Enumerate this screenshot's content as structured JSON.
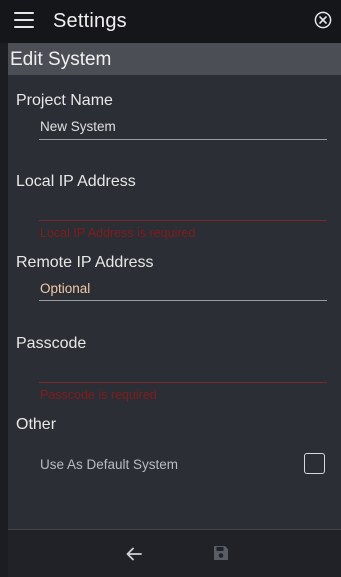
{
  "topbar": {
    "title": "Settings",
    "menu_icon": "hamburger-menu-icon",
    "close_icon": "close-circle-icon"
  },
  "panel": {
    "title": "Edit System"
  },
  "form": {
    "project_name": {
      "label": "Project Name",
      "value": "New System"
    },
    "local_ip": {
      "label": "Local IP Address",
      "value": "",
      "error": "Local IP Address is required"
    },
    "remote_ip": {
      "label": "Remote IP Address",
      "value": "",
      "placeholder": "Optional"
    },
    "passcode": {
      "label": "Passcode",
      "value": "",
      "error": "Passcode is required"
    },
    "other": {
      "label": "Other",
      "default_label": "Use As Default System",
      "default_checked": false
    }
  },
  "footer": {
    "back_icon": "arrow-left-icon",
    "save_icon": "save-icon"
  },
  "colors": {
    "error": "#7f1d1d",
    "placeholder": "#f2c9a8",
    "header": "#4b4e55"
  }
}
